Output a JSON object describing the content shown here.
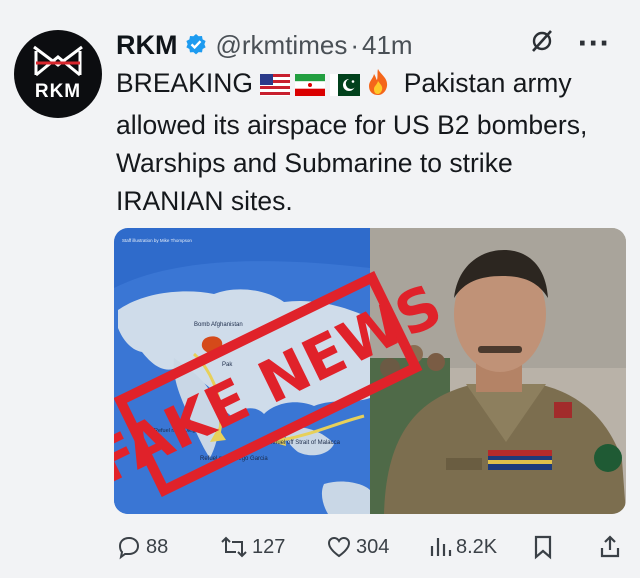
{
  "author": {
    "avatar_text": "RKM",
    "name": "RKM",
    "handle": "@rkmtimes",
    "separator": "·",
    "time": "41m"
  },
  "tweet": {
    "text_lead": "BREAKING",
    "text_body": "Pakistan army allowed its airspace for US B2 bombers, Warships and Submarine to strike IRANIAN sites.",
    "emojis": [
      "us-flag-emoji",
      "iran-flag-emoji",
      "pakistan-flag-emoji",
      "fire-emoji"
    ]
  },
  "media": {
    "stamp_text": "FAKE NEWS",
    "map_labels": {
      "header": "Staff illustration by Mike Thompson",
      "bomb": "Bomb Afghanistan",
      "pak": "Pak",
      "refuel_diego_left": "Refuel near Diego Garcia",
      "refuel_diego": "Refuel near Diego Garcia",
      "refuel_malacca": "Refuel off Strait of Malacca"
    }
  },
  "actions": {
    "replies": "88",
    "reposts": "127",
    "likes": "304",
    "views": "8.2K"
  },
  "colors": {
    "background": "#f2f3f5",
    "verified_blue": "#1d9bf0",
    "stamp_red": "#e0222a",
    "ocean": "#2f6bcb"
  }
}
